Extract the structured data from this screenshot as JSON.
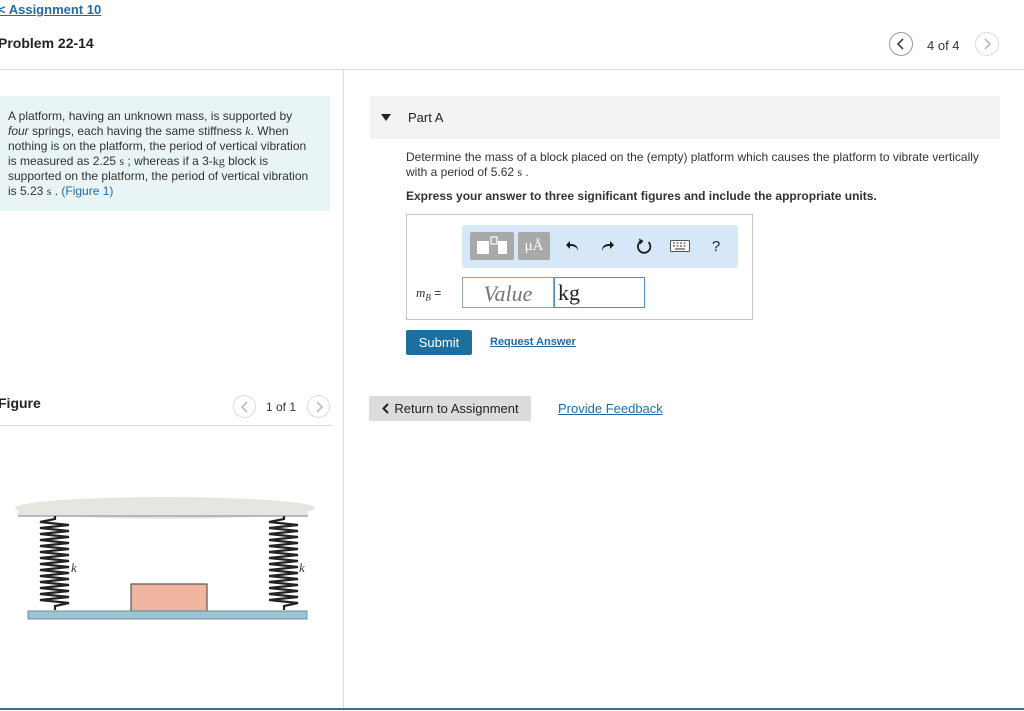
{
  "header": {
    "back_link": "< Assignment 10",
    "problem_title": "Problem 22-14",
    "page_indicator": "4 of 4",
    "prev_icon": "chevron-left-icon",
    "next_icon": "chevron-right-icon"
  },
  "problem": {
    "t1": "A platform, having an unknown mass, is supported by",
    "t2_italic": "four",
    "t2": " springs, each having the same stiffness ",
    "t2_sym": "k",
    "t2_end": ". When",
    "t3": "nothing is on the platform, the period of vertical vibration",
    "t4a": "is measured as 2.25 ",
    "t4_unit": "s",
    "t4b": " ; whereas if a 3-",
    "t4_kg": "kg",
    "t4c": " block is",
    "t5": "supported on the platform, the period of vertical vibration",
    "t6a": "is 5.23 ",
    "t6_unit": "s",
    "t6b": " . ",
    "figure_link": "(Figure 1)"
  },
  "figure": {
    "title": "Figure",
    "page_indicator": "1 of 1",
    "spring_label": "k",
    "colors": {
      "platform": "#9cc4d4",
      "block": "#f0b6a0",
      "ceiling": "#e6e6e0"
    }
  },
  "part": {
    "label": "Part A",
    "arrow_icon": "caret-down-icon",
    "q1": "Determine the mass of a block placed on the (empty) platform which causes the platform to vibrate vertically",
    "q2a": "with a period of 5.62 ",
    "q2_unit": "s",
    "q2b": " .",
    "instruction": "Express your answer to three significant figures and include the appropriate units."
  },
  "answer": {
    "var_main": "m",
    "var_sub": "B",
    "equals": " =",
    "value_placeholder": "Value",
    "unit_value": "kg",
    "toolbar": {
      "templates_icon": "templates-icon",
      "units_label": "μÅ",
      "undo_icon": "undo-icon",
      "redo_icon": "redo-icon",
      "reset_icon": "reset-icon",
      "keyboard_icon": "keyboard-icon",
      "help_label": "?"
    }
  },
  "actions": {
    "submit": "Submit",
    "request_answer": "Request Answer",
    "return_assignment": "Return to Assignment",
    "provide_feedback": "Provide Feedback"
  },
  "colors": {
    "accent": "#1c6f9e",
    "link": "#1f6ca8",
    "problem_bg": "#e9f4f4",
    "toolbar_bg": "#d6e8f7"
  }
}
